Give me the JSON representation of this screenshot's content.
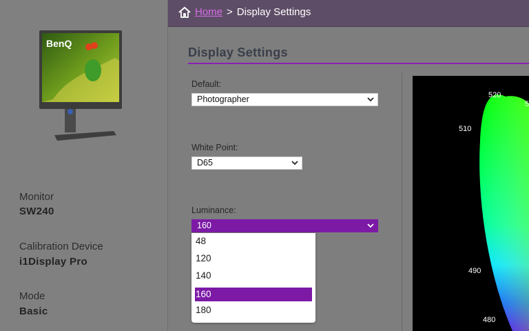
{
  "sidebar": {
    "brand": "BenQ",
    "monitor_label": "Monitor",
    "monitor_value": "SW240",
    "device_label": "Calibration Device",
    "device_value": "i1Display Pro",
    "mode_label": "Mode",
    "mode_value": "Basic"
  },
  "header": {
    "home": "Home",
    "separator": ">",
    "current": "Display Settings"
  },
  "main": {
    "title": "Display Settings",
    "default": {
      "label": "Default:",
      "value": "Photographer"
    },
    "white_point": {
      "label": "White Point:",
      "value": "D65"
    },
    "luminance": {
      "label": "Luminance:",
      "value": "160",
      "options": [
        "48",
        "120",
        "140",
        "160",
        "180"
      ],
      "selected_index": 3
    },
    "chart_labels": [
      "520",
      "5",
      "510",
      "490",
      "480"
    ]
  },
  "colors": {
    "accent": "#7c1aa6",
    "link": "#d66de8",
    "header_bg": "#5e4d66"
  }
}
